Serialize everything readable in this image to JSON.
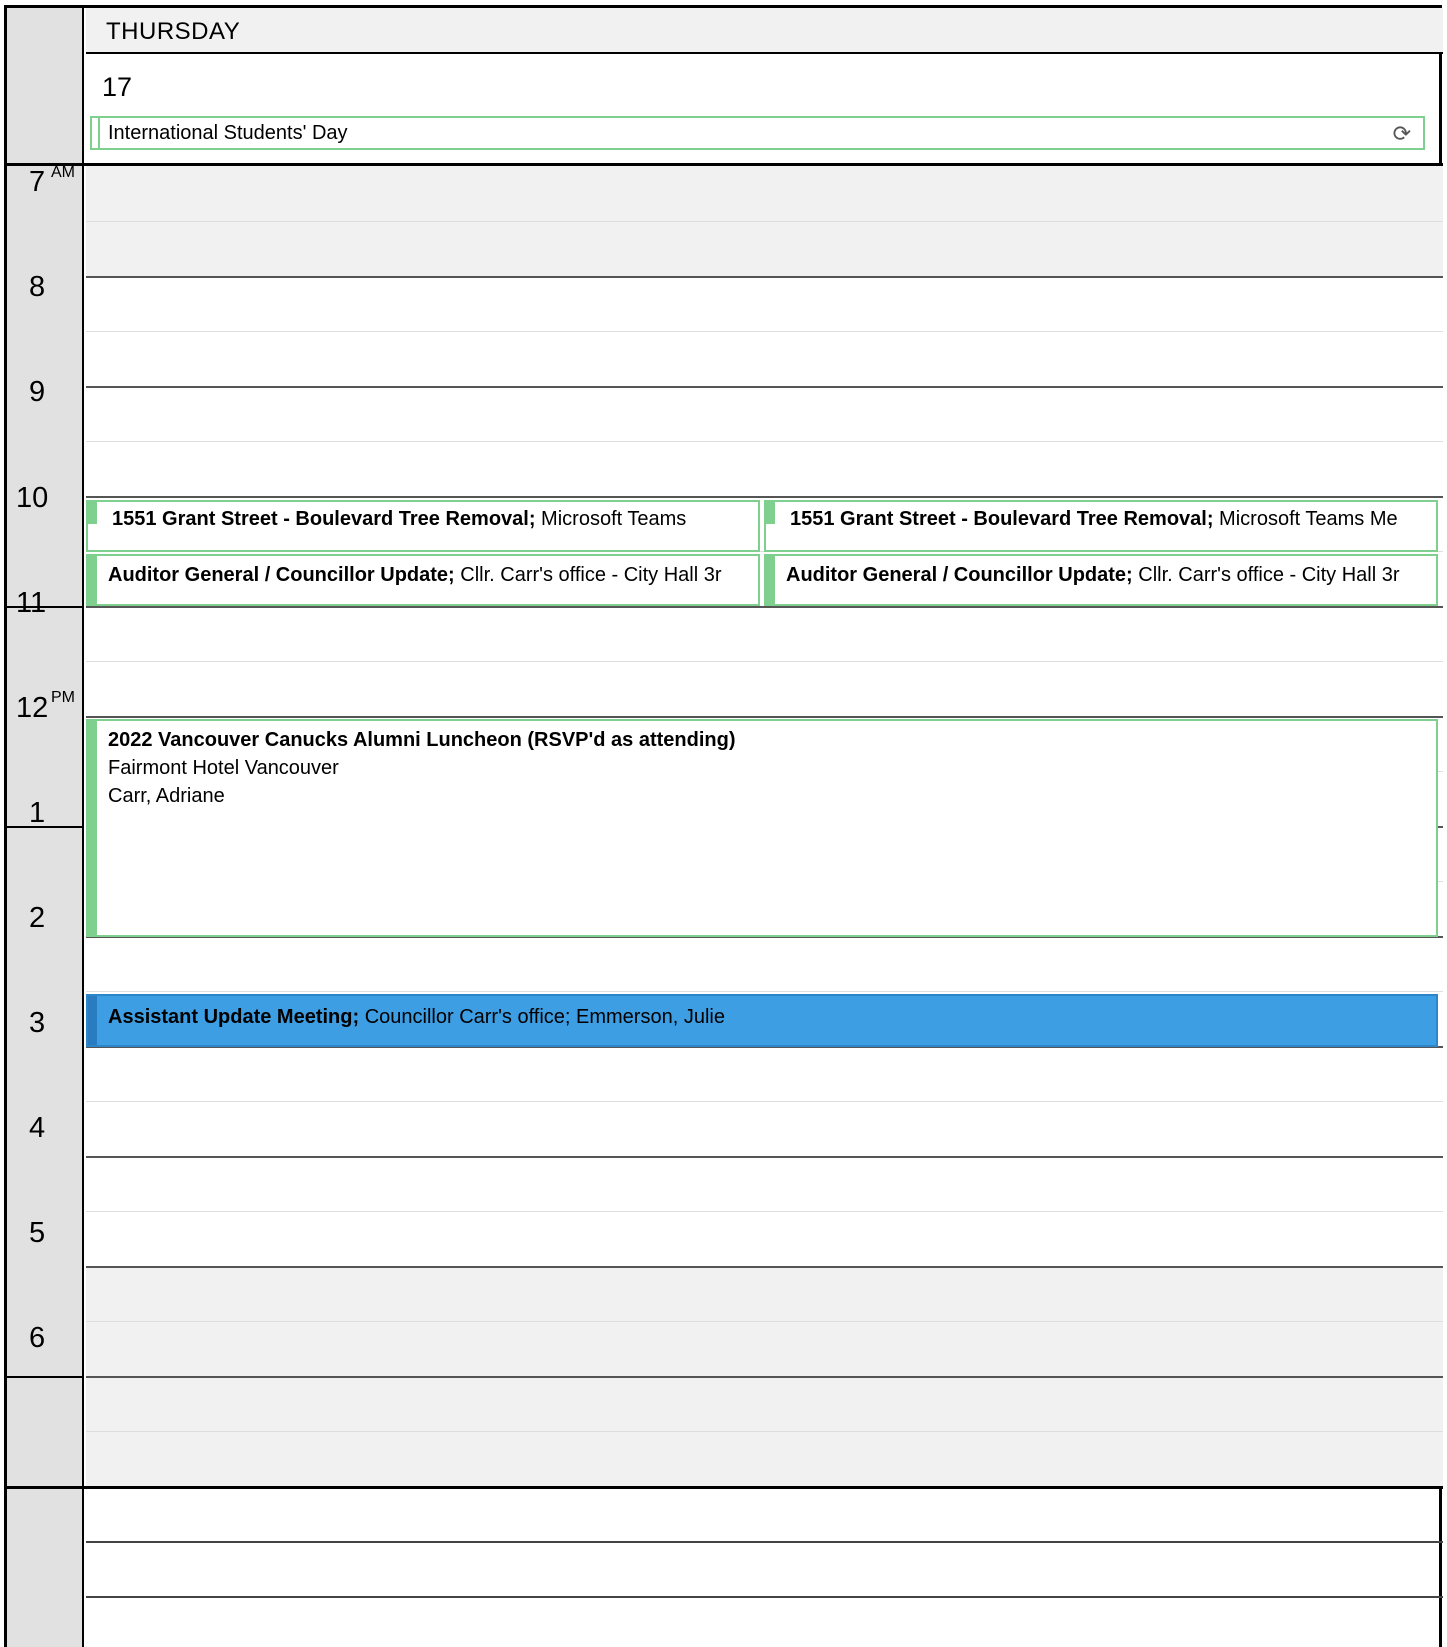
{
  "day": {
    "name": "THURSDAY",
    "number": "17",
    "all_day_event": "International Students' Day",
    "all_day_icon": "recurrence-icon"
  },
  "hours": [
    {
      "label": "7",
      "suffix": "AM"
    },
    {
      "label": "8",
      "suffix": ""
    },
    {
      "label": "9",
      "suffix": ""
    },
    {
      "label": "10",
      "suffix": ""
    },
    {
      "label": "11",
      "suffix": ""
    },
    {
      "label": "12",
      "suffix": "PM"
    },
    {
      "label": "1",
      "suffix": ""
    },
    {
      "label": "2",
      "suffix": ""
    },
    {
      "label": "3",
      "suffix": ""
    },
    {
      "label": "4",
      "suffix": ""
    },
    {
      "label": "5",
      "suffix": ""
    },
    {
      "label": "6",
      "suffix": ""
    }
  ],
  "events": {
    "grant_left": {
      "title": "1551 Grant Street - Boulevard Tree Removal;",
      "detail": " Microsoft Teams "
    },
    "grant_right": {
      "title": "1551 Grant Street - Boulevard Tree Removal;",
      "detail": " Microsoft Teams Me"
    },
    "auditor_left": {
      "title": "Auditor General / Councillor Update;",
      "detail": " Cllr. Carr's office - City Hall 3r"
    },
    "auditor_right": {
      "title": "Auditor General / Councillor Update;",
      "detail": " Cllr. Carr's office - City Hall 3r"
    },
    "luncheon": {
      "title": "2022 Vancouver Canucks Alumni Luncheon (RSVP'd as attending)",
      "location": "Fairmont Hotel Vancouver",
      "organizer": "Carr, Adriane"
    },
    "assistant": {
      "title": "Assistant Update Meeting;",
      "detail": " Councillor Carr's office; Emmerson, Julie"
    }
  },
  "colors": {
    "event_border": "#7fcf8f",
    "busy_blue": "#3d9ee3",
    "off_hours_gray": "#f1f1f1"
  }
}
